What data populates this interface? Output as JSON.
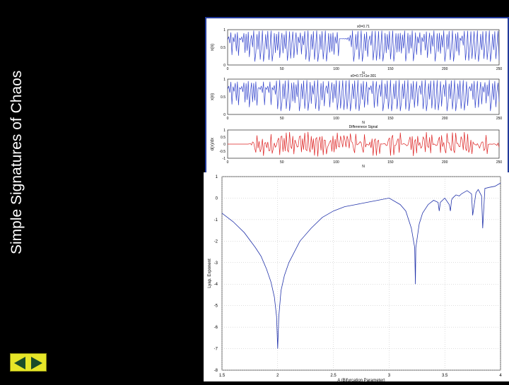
{
  "slide": {
    "title": "Simple Signatures of Chaos"
  },
  "colors": {
    "background": "#000000",
    "signal": "#3344cc",
    "difference": "#dd2222",
    "lyapunov": "#2233aa",
    "nav_button": "#e6e628"
  },
  "nav": {
    "prev_icon": "triangle-left-icon",
    "next_icon": "triangle-right-icon"
  },
  "chart_data": [
    {
      "type": "line",
      "panels": [
        {
          "title": "x0=0.71",
          "ylabel": "x(n)",
          "xlabel": "N",
          "xlim": [
            0,
            250
          ],
          "ylim": [
            0,
            1
          ],
          "yticks": [
            "0",
            "0.5",
            "1"
          ],
          "xticks": [
            "0",
            "50",
            "100",
            "150",
            "200",
            "250"
          ],
          "series": [
            {
              "values": "chaotic oscillation between 0 and 1"
            }
          ]
        },
        {
          "title": "x0=0.71+1e-301",
          "ylabel": "x(n)",
          "xlabel": "N",
          "xlim": [
            0,
            250
          ],
          "ylim": [
            0,
            1
          ],
          "yticks": [
            "0",
            "0.5",
            "1"
          ],
          "xticks": [
            "0",
            "50",
            "100",
            "150",
            "200",
            "250"
          ],
          "series": [
            {
              "values": "chaotic oscillation between 0 and 1"
            }
          ]
        },
        {
          "title": "Differenece Signal",
          "ylabel": "d(x)/dx",
          "xlabel": "N",
          "xlim": [
            0,
            250
          ],
          "ylim": [
            -1,
            1
          ],
          "yticks": [
            "-1",
            "-0.5",
            "0",
            "0.5",
            "1"
          ],
          "xticks": [
            "0",
            "50",
            "100",
            "150",
            "200",
            "250"
          ],
          "series": [
            {
              "values": "chaotic oscillation between -1 and 1"
            }
          ]
        }
      ],
      "labels": {
        "p1_title": "x0=0.71",
        "p2_title": "x0=0.71+1e-301",
        "p3_title": "Differenece Signal",
        "p1_ylabel": "x(n)",
        "p2_ylabel": "x(n)",
        "p3_ylabel": "d(x)/dx",
        "xlabel": "N",
        "x_ticks": [
          "0",
          "50",
          "100",
          "150",
          "200",
          "250"
        ],
        "y_ticks_signal": [
          "0",
          "0.5",
          "1"
        ],
        "y_ticks_diff": [
          "-1",
          "-0.5",
          "0",
          "0.5",
          "1"
        ]
      }
    },
    {
      "type": "line",
      "title": "",
      "xlabel": "A (Bifurcation Parameter)",
      "ylabel": "Lyap. Exponent",
      "xlim": [
        1.5,
        4
      ],
      "ylim": [
        -8,
        1
      ],
      "grid": true,
      "x_ticks": [
        "1.5",
        "2",
        "2.5",
        "3",
        "3.5",
        "4"
      ],
      "y_ticks": [
        "1",
        "0",
        "-1",
        "-2",
        "-3",
        "-4",
        "-5",
        "-6",
        "-7",
        "-8"
      ],
      "series": [
        {
          "x": [
            1.5,
            1.6,
            1.7,
            1.8,
            1.85,
            1.9,
            1.94,
            1.97,
            1.99,
            2.0,
            2.01,
            2.03,
            2.06,
            2.1,
            2.2,
            2.3,
            2.4,
            2.5,
            2.6,
            2.7,
            2.8,
            2.9,
            3.0,
            3.1,
            3.15,
            3.2,
            3.23,
            3.236,
            3.24,
            3.27,
            3.3,
            3.35,
            3.4,
            3.44,
            3.45,
            3.46,
            3.5,
            3.54,
            3.55,
            3.56,
            3.57,
            3.6,
            3.63,
            3.65,
            3.7,
            3.74,
            3.75,
            3.78,
            3.8,
            3.83,
            3.84,
            3.86,
            3.9,
            3.95,
            4.0
          ],
          "y": [
            -0.7,
            -1.1,
            -1.6,
            -2.3,
            -2.7,
            -3.3,
            -3.9,
            -4.6,
            -5.5,
            -7.0,
            -5.5,
            -4.3,
            -3.6,
            -3.0,
            -2.0,
            -1.4,
            -0.9,
            -0.6,
            -0.4,
            -0.3,
            -0.2,
            -0.1,
            0.0,
            -0.3,
            -0.6,
            -1.4,
            -2.3,
            -4.0,
            -2.3,
            -1.2,
            -0.7,
            -0.3,
            -0.1,
            -0.2,
            -0.6,
            -0.2,
            0.0,
            -0.3,
            -0.6,
            -0.1,
            0.0,
            0.15,
            0.1,
            0.2,
            0.35,
            0.2,
            -0.8,
            0.25,
            0.4,
            0.1,
            -1.4,
            0.45,
            0.5,
            0.55,
            0.7
          ]
        }
      ]
    }
  ]
}
